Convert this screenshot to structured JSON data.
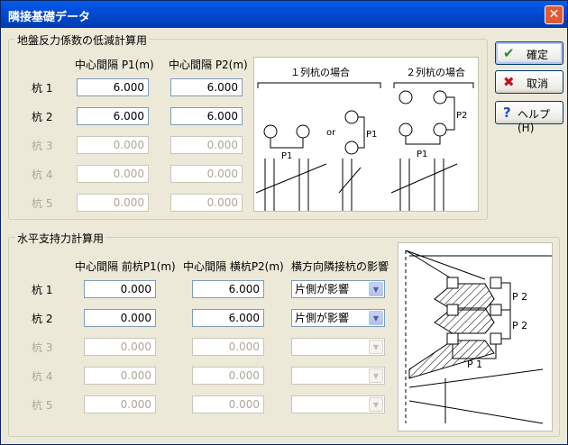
{
  "window": {
    "title": "隣接基礎データ",
    "close": "✕"
  },
  "buttons": {
    "ok": {
      "label": "確定",
      "icon": "checkmark-icon",
      "icon_glyph": "✔",
      "icon_color": "#2E8B2E"
    },
    "cancel": {
      "label": "取消",
      "icon": "x-icon",
      "icon_glyph": "✖",
      "icon_color": "#C0141B"
    },
    "help": {
      "label": "ヘルプ(H)",
      "icon": "question-icon",
      "icon_glyph": "?",
      "icon_color": "#1B4FC4"
    }
  },
  "group1": {
    "title": "地盤反力係数の低減計算用",
    "col_p1": "中心間隔 P1(m)",
    "col_p2": "中心間隔 P2(m)",
    "rows": [
      {
        "label": "杭 1",
        "p1": "6.000",
        "p2": "6.000",
        "enabled": true
      },
      {
        "label": "杭 2",
        "p1": "6.000",
        "p2": "6.000",
        "enabled": true
      },
      {
        "label": "杭 3",
        "p1": "0.000",
        "p2": "0.000",
        "enabled": false
      },
      {
        "label": "杭 4",
        "p1": "0.000",
        "p2": "0.000",
        "enabled": false
      },
      {
        "label": "杭 5",
        "p1": "0.000",
        "p2": "0.000",
        "enabled": false
      }
    ],
    "diagram": {
      "case1": "１列杭の場合",
      "case2": "２列杭の場合",
      "or": "or",
      "p1": "P1",
      "p2": "P2"
    }
  },
  "group2": {
    "title": "水平支持力計算用",
    "col_p1": "中心間隔 前杭P1(m)",
    "col_p2": "中心間隔 横杭P2(m)",
    "col_effect": "横方向隣接杭の影響",
    "rows": [
      {
        "label": "杭 1",
        "p1": "0.000",
        "p2": "6.000",
        "effect": "片側が影響",
        "enabled": true
      },
      {
        "label": "杭 2",
        "p1": "0.000",
        "p2": "6.000",
        "effect": "片側が影響",
        "enabled": true
      },
      {
        "label": "杭 3",
        "p1": "0.000",
        "p2": "0.000",
        "effect": "",
        "enabled": false
      },
      {
        "label": "杭 4",
        "p1": "0.000",
        "p2": "0.000",
        "effect": "",
        "enabled": false
      },
      {
        "label": "杭 5",
        "p1": "0.000",
        "p2": "0.000",
        "effect": "",
        "enabled": false
      }
    ],
    "diagram": {
      "p1": "P 1",
      "p2a": "P 2",
      "p2b": "P 2"
    }
  }
}
